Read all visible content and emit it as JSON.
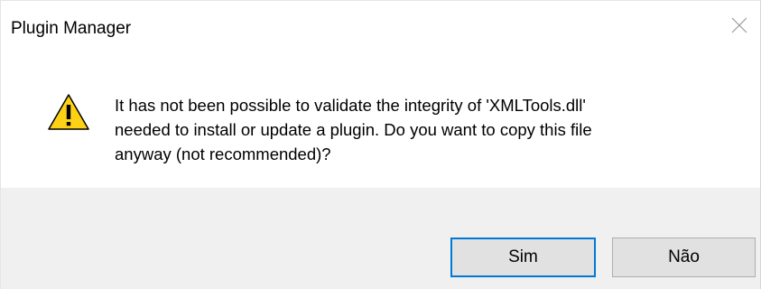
{
  "window": {
    "title": "Plugin Manager",
    "close_icon": "close-icon"
  },
  "message": {
    "icon": "warning-icon",
    "text": "It has not been possible to validate the integrity of 'XMLTools.dll'\nneeded to install or update a plugin.  Do you want to copy this file\nanyway (not recommended)?"
  },
  "buttons": {
    "yes_label": "Sim",
    "no_label": "Não",
    "default": "yes"
  },
  "colors": {
    "warning_fill": "#fcd116",
    "warning_stroke": "#000000",
    "footer_background": "#f0f0f0",
    "default_button_border": "#0078d7"
  }
}
